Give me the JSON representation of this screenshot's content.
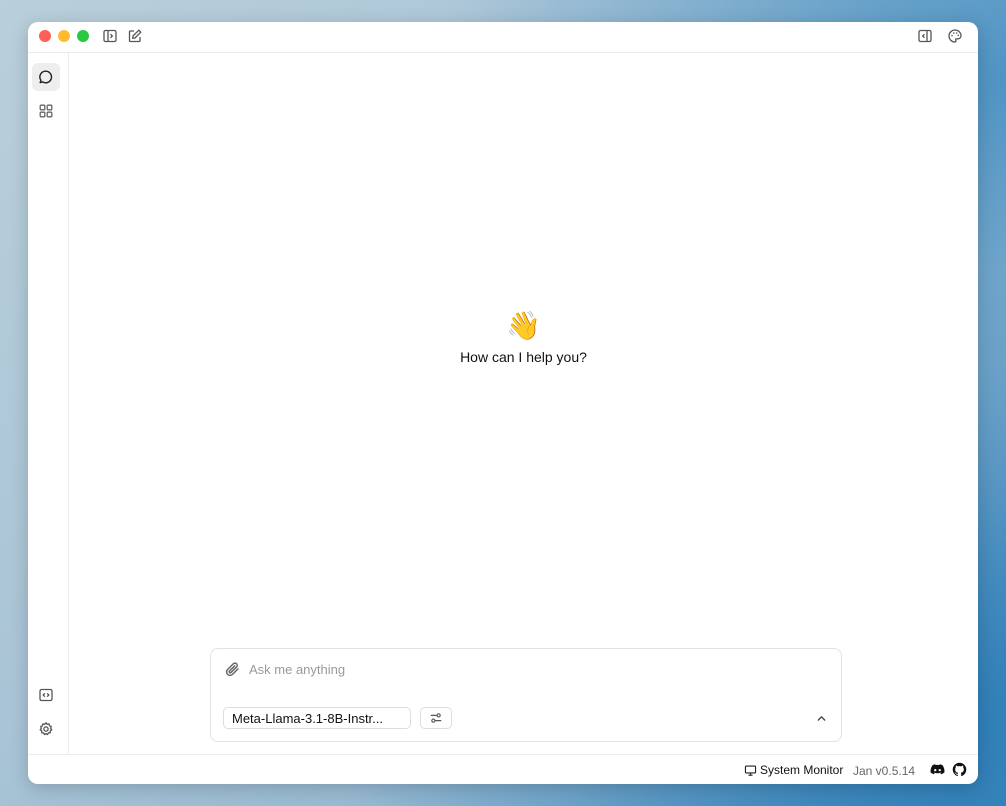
{
  "welcome": {
    "emoji": "👋",
    "text": "How can I help you?"
  },
  "composer": {
    "placeholder": "Ask me anything",
    "value": "",
    "model": "Meta-Llama-3.1-8B-Instr..."
  },
  "statusbar": {
    "system_monitor": "System Monitor",
    "version": "Jan v0.5.14"
  },
  "icons": {
    "titlebar_left": [
      "sidebar-toggle-icon",
      "new-chat-icon"
    ],
    "titlebar_right": [
      "right-panel-toggle-icon",
      "palette-icon"
    ],
    "sidebar_top": [
      "chat-icon",
      "grid-icon"
    ],
    "sidebar_bottom": [
      "code-icon",
      "gear-icon"
    ],
    "social": [
      "discord-icon",
      "github-icon"
    ]
  },
  "colors": {
    "traffic_red": "#fe5f57",
    "traffic_yellow": "#febc2e",
    "traffic_green": "#28c840",
    "border": "#e3e3e3"
  }
}
